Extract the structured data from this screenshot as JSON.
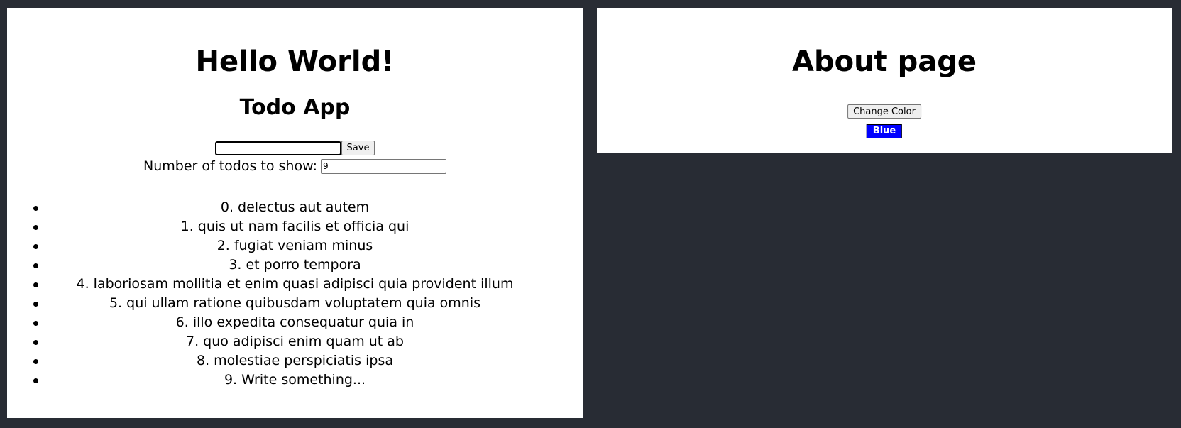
{
  "home": {
    "title": "Hello World!",
    "subtitle": "Todo App",
    "new_todo_value": "",
    "save_label": "Save",
    "count_label": "Number of todos to show:",
    "count_value": "9",
    "todos": [
      "0. delectus aut autem",
      "1. quis ut nam facilis et officia qui",
      "2. fugiat veniam minus",
      "3. et porro tempora",
      "4. laboriosam mollitia et enim quasi adipisci quia provident illum",
      "5. qui ullam ratione quibusdam voluptatem quia omnis",
      "6. illo expedita consequatur quia in",
      "7. quo adipisci enim quam ut ab",
      "8. molestiae perspiciatis ipsa",
      "9. Write something..."
    ]
  },
  "about": {
    "title": "About page",
    "change_color_label": "Change Color",
    "color_name": "Blue",
    "color_hex": "#0000ff"
  },
  "theme": {
    "background": "#282c34",
    "panel": "#ffffff"
  }
}
